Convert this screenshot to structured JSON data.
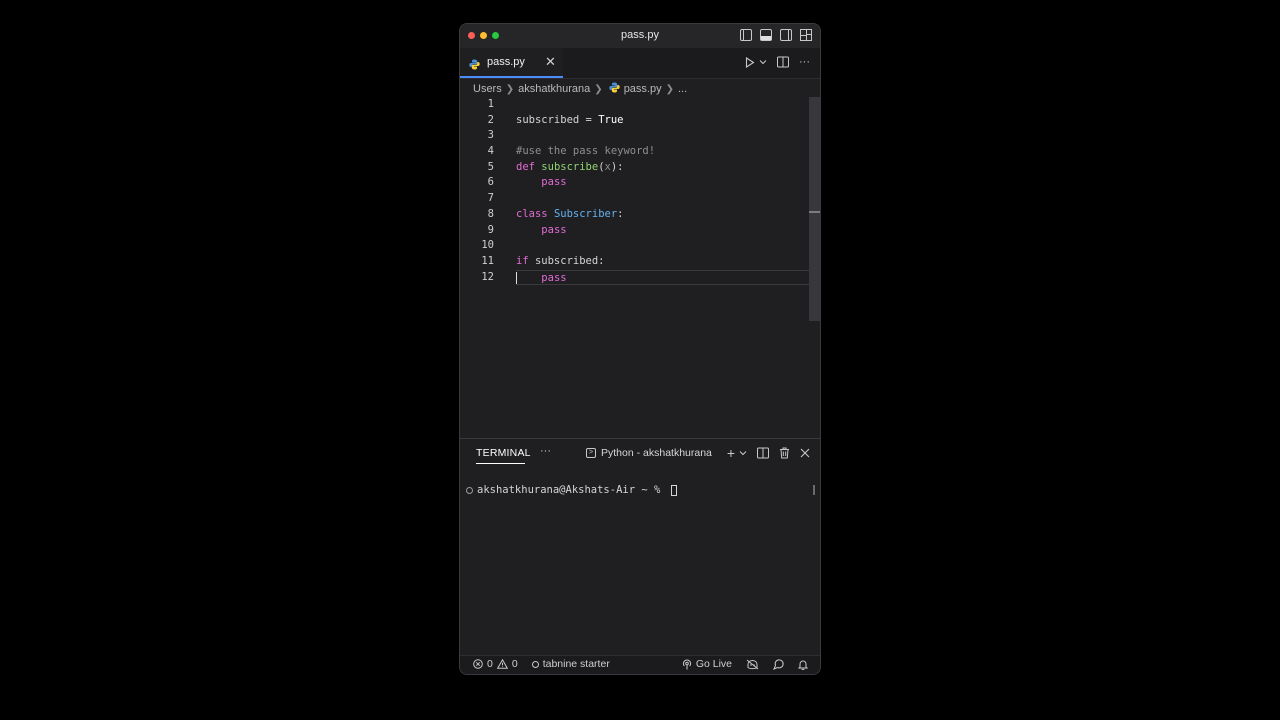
{
  "window": {
    "title": "pass.py"
  },
  "tab": {
    "label": "pass.py",
    "close": "✕"
  },
  "breadcrumb": {
    "items": [
      "Users",
      "akshatkhurana",
      "pass.py",
      "..."
    ]
  },
  "editor": {
    "line_numbers": [
      "1",
      "2",
      "3",
      "4",
      "5",
      "6",
      "7",
      "8",
      "9",
      "10",
      "11",
      "12"
    ],
    "lines": [
      [],
      [
        {
          "t": "subscribed = ",
          "c": ""
        },
        {
          "t": "True",
          "c": "const"
        }
      ],
      [],
      [
        {
          "t": "#use the pass keyword!",
          "c": "cmt"
        }
      ],
      [
        {
          "t": "def ",
          "c": "kw"
        },
        {
          "t": "subscribe",
          "c": "fn"
        },
        {
          "t": "(",
          "c": ""
        },
        {
          "t": "x",
          "c": "param"
        },
        {
          "t": "):",
          "c": ""
        }
      ],
      [
        {
          "t": "    ",
          "c": ""
        },
        {
          "t": "pass",
          "c": "kw"
        }
      ],
      [],
      [
        {
          "t": "class ",
          "c": "kw"
        },
        {
          "t": "Subscriber",
          "c": "cls"
        },
        {
          "t": ":",
          "c": ""
        }
      ],
      [
        {
          "t": "    ",
          "c": ""
        },
        {
          "t": "pass",
          "c": "kw"
        }
      ],
      [],
      [
        {
          "t": "if ",
          "c": "kw"
        },
        {
          "t": "subscribed:",
          "c": ""
        }
      ],
      [
        {
          "t": "    ",
          "c": ""
        },
        {
          "t": "pass",
          "c": "kw"
        }
      ]
    ],
    "current_line": 12
  },
  "panel": {
    "tab_label": "TERMINAL",
    "more": "···",
    "terminal_name": "Python - akshatkhurana",
    "prompt": "akshatkhurana@Akshats-Air ~ % "
  },
  "status": {
    "errors": "0",
    "warnings": "0",
    "tabnine": "tabnine starter",
    "go_live": "Go Live"
  },
  "colors": {
    "accent": "#4b8df8",
    "keyword": "#e06cd3",
    "function": "#8fd46f",
    "class": "#65b1ee"
  }
}
